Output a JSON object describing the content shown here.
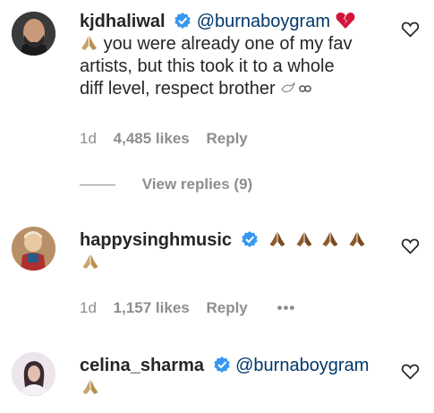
{
  "comments": [
    {
      "username": "kjdhaliwal",
      "mention": "@burnaboygram",
      "text_line1": "you were already one of my fav",
      "text_line2": "artists, but this took it to a whole",
      "text_line3": "diff level, respect brother",
      "meta_time": "1d",
      "meta_likes": "4,485 likes",
      "meta_reply": "Reply",
      "view_replies": "View replies (9)",
      "colors": {
        "avatar_bg": "#2b2b2b",
        "mention": "#00376b",
        "broken_heart": "#d4143b"
      }
    },
    {
      "username": "happysinghmusic",
      "meta_time": "1d",
      "meta_likes": "1,157 likes",
      "meta_reply": "Reply",
      "meta_more": "•••",
      "colors": {
        "avatar_bg": "#c9a57a"
      }
    },
    {
      "username": "celina_sharma",
      "mention": "@burnaboygram",
      "colors": {
        "avatar_bg": "#e6e0e8"
      }
    }
  ],
  "icons": {
    "verified": "verified-badge-icon",
    "like": "heart-outline-icon",
    "praying_hands": "praying-hands-emoji",
    "broken_heart": "broken-heart-emoji",
    "dove_infinity": "dove-infinity-emoji"
  },
  "colors": {
    "verified": "#3897f0",
    "meta": "#8e8e8e",
    "text": "#262626"
  }
}
